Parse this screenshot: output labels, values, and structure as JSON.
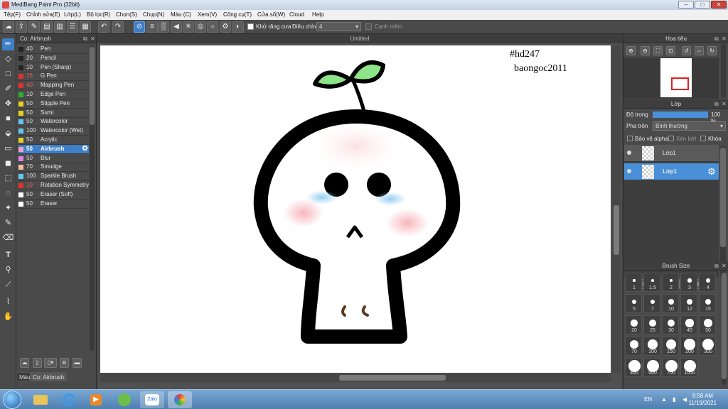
{
  "window": {
    "title": "MediBang Paint Pro (32bit)",
    "min": "–",
    "max": "□",
    "close": "✕"
  },
  "menu": [
    "Tệp(F)",
    "Chỉnh sửa(E)",
    "Lớp(L)",
    "Bộ lọc(R)",
    "Chọn(S)",
    "Chụp(N)",
    "Màu (C)",
    "Xem(V)",
    "Công cụ(T)",
    "Cửa sổ(W)",
    "Cloud",
    "Help"
  ],
  "toolbar": {
    "antialias_label": "Khử răng cưa",
    "correction_label": "Điều chỉnh",
    "correction_value": "4",
    "snap_label": "Cạnh mềm"
  },
  "brush_panel": {
    "title": "Cọ: Airbrush",
    "brushes": [
      {
        "size": "40",
        "name": "Pen",
        "color": "#222222"
      },
      {
        "size": "20",
        "name": "Pencil",
        "color": "#222222"
      },
      {
        "size": "10",
        "name": "Pen (Sharp)",
        "color": "#222222"
      },
      {
        "size": "15",
        "name": "G Pen",
        "color": "#e03030"
      },
      {
        "size": "40",
        "name": "Mapping Pen",
        "color": "#e03030"
      },
      {
        "size": "10",
        "name": "Edge Pen",
        "color": "#30b030"
      },
      {
        "size": "50",
        "name": "Stipple Pen",
        "color": "#e8d020"
      },
      {
        "size": "50",
        "name": "Sumi",
        "color": "#e8d020"
      },
      {
        "size": "50",
        "name": "Watercolor",
        "color": "#60c8f0"
      },
      {
        "size": "100",
        "name": "Watercolor (Wet)",
        "color": "#60c8f0"
      },
      {
        "size": "50",
        "name": "Acrylic",
        "color": "#e8d020"
      },
      {
        "size": "50",
        "name": "Airbrush",
        "color": "#f0a0c8"
      },
      {
        "size": "50",
        "name": "Blur",
        "color": "#e080e0"
      },
      {
        "size": "70",
        "name": "Smudge",
        "color": "#f0c0a0"
      },
      {
        "size": "100",
        "name": "Sparkle Brush",
        "color": "#60c8f0"
      },
      {
        "size": "10",
        "name": "Rotation Symmetry",
        "color": "#e03030"
      },
      {
        "size": "50",
        "name": "Eraser (Soft)",
        "color": "#ffffff"
      },
      {
        "size": "50",
        "name": "Eraser",
        "color": "#ffffff"
      }
    ],
    "selected": "Airbrush",
    "tabs": [
      "Màu",
      "Cọ: Airbrush"
    ]
  },
  "canvas": {
    "doc_title": "Untitled",
    "text_line1": "#hd247",
    "text_line2": "baongoc2011"
  },
  "navigator": {
    "title": "Hoa tiêu"
  },
  "layers": {
    "title": "Lớp",
    "opacity_label": "Độ trong",
    "opacity_value": "100 %",
    "opacity": 1.0,
    "blend_label": "Pha trộn",
    "blend_value": "Bình thường",
    "protect_alpha": "Bảo vệ alpha",
    "clipping": "Xén bớt",
    "lock": "Khóa",
    "items": [
      {
        "name": "Lớp1"
      },
      {
        "name": "Lớp1",
        "selected": true
      }
    ]
  },
  "brush_size": {
    "title": "Brush Size",
    "sizes": [
      "1",
      "1.5",
      "2",
      "3",
      "4",
      "5",
      "7",
      "10",
      "12",
      "15",
      "20",
      "25",
      "30",
      "40",
      "50",
      "70",
      "100",
      "150",
      "200",
      "300",
      "400",
      "500",
      "700",
      "1000"
    ]
  },
  "taskbar": {
    "lang": "EN",
    "time": "9:58 AM",
    "date": "11/19/2021"
  }
}
